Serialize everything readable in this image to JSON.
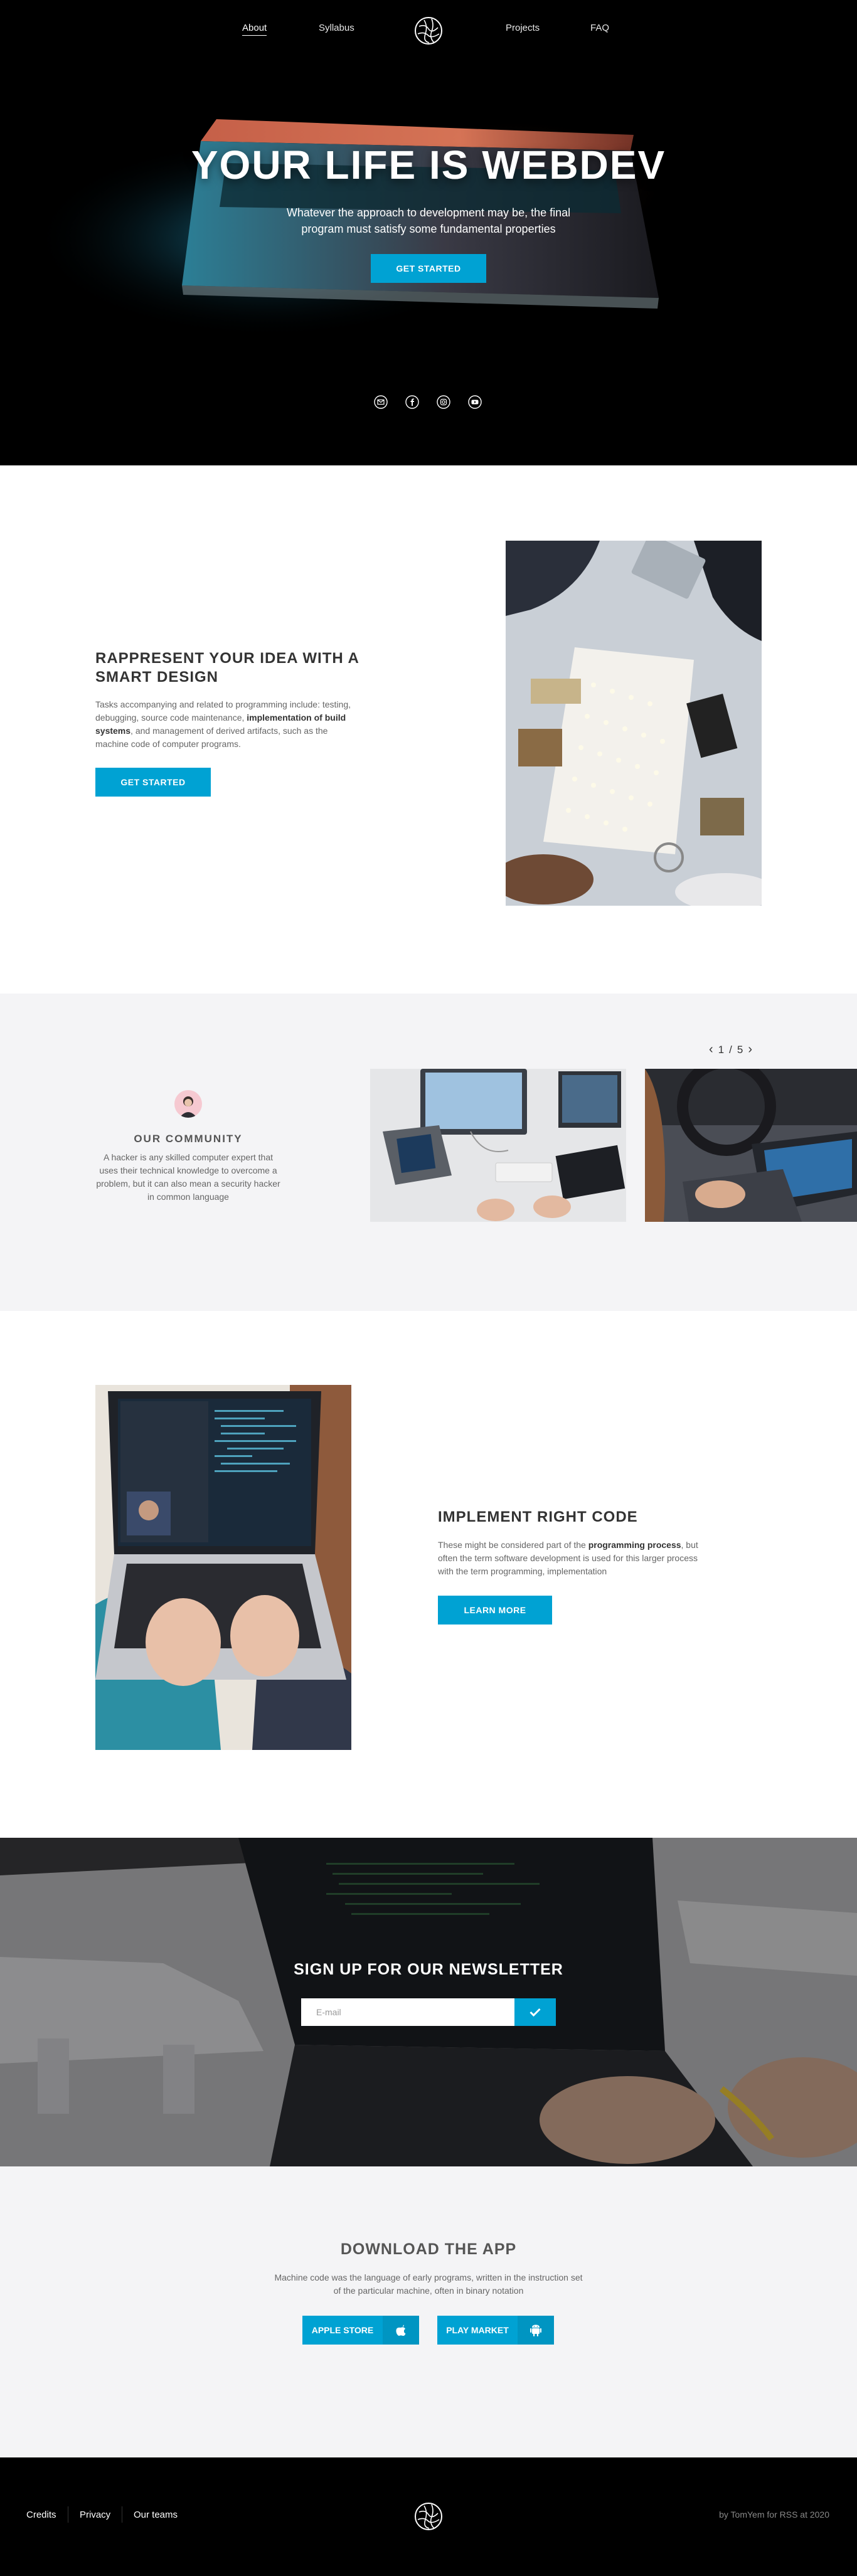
{
  "nav": {
    "links": [
      "About",
      "Syllabus",
      "Projects",
      "FAQ"
    ],
    "active": "About"
  },
  "hero": {
    "title": "YOUR LIFE IS WEBDEV",
    "subtitle": "Whatever the approach to development may be, the final program must satisfy some fundamental properties",
    "cta": "GET STARTED",
    "socials": [
      "mail-icon",
      "facebook-icon",
      "instagram-icon",
      "youtube-icon"
    ]
  },
  "feature1": {
    "title": "RAPPRESENT YOUR IDEA WITH A SMART DESIGN",
    "text_pre": "Tasks accompanying and related to programming include: testing, debugging, source code maintenance, ",
    "text_bold": "implementation of build systems",
    "text_post": ", and management of derived artifacts, such as the machine code of computer programs.",
    "cta": "GET STARTED"
  },
  "community": {
    "title": "OUR COMMUNITY",
    "text": "A hacker is any skilled computer expert that uses their technical knowledge to overcome a problem, but it can also mean a security hacker in common language",
    "pager": {
      "current": "1",
      "separator": "/",
      "total": "5"
    }
  },
  "feature2": {
    "title": "IMPLEMENT RIGHT CODE",
    "text_pre": "These might be considered part of the ",
    "text_bold": "programming process",
    "text_post": ", but often the term software development is used for this larger process with the term programming, implementation",
    "cta": "LEARN MORE"
  },
  "newsletter": {
    "title": "SIGN UP FOR OUR NEWSLETTER",
    "placeholder": "E-mail",
    "submit_icon": "check-icon"
  },
  "download": {
    "title": "DOWNLOAD THE APP",
    "text": "Machine code was the language of early programs, written in the instruction set of the particular machine, often in binary notation",
    "apple_label": "APPLE STORE",
    "play_label": "PLAY MARKET"
  },
  "footer": {
    "links": [
      "Credits",
      "Privacy",
      "Our teams"
    ],
    "credit": "by TomYem for RSS at 2020"
  },
  "colors": {
    "accent": "#00a2d3",
    "dark": "#000000",
    "light_section": "#f4f4f6"
  }
}
